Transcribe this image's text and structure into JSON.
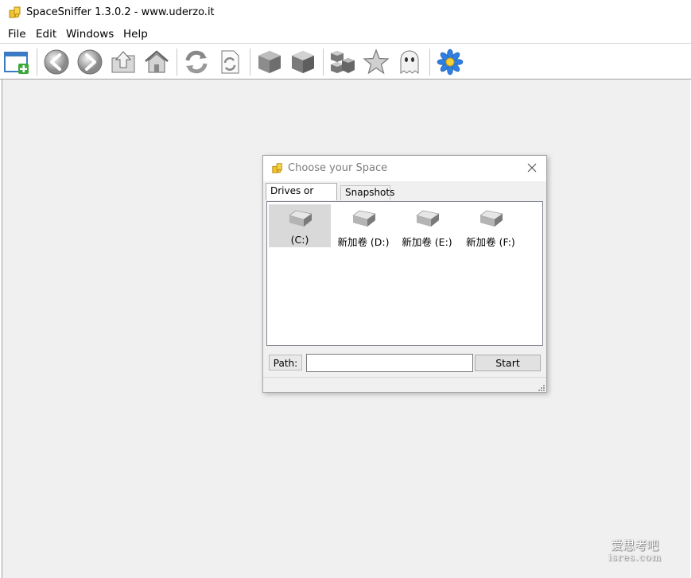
{
  "window": {
    "title": "SpaceSniffer 1.3.0.2 - www.uderzo.it"
  },
  "menu": [
    "File",
    "Edit",
    "Windows",
    "Help"
  ],
  "toolbar": {
    "buttons": [
      "new-window-icon",
      "back-icon",
      "forward-icon",
      "parent-folder-icon",
      "home-icon",
      "refresh-icon",
      "refresh-document-icon",
      "cube-icon",
      "cube-outline-icon",
      "cubes-icon",
      "star-icon",
      "ghost-icon",
      "flower-icon"
    ]
  },
  "dialog": {
    "title": "Choose your Space",
    "tabs": [
      "Drives or Paths",
      "Snapshots"
    ],
    "drives": [
      {
        "label": "(C:)",
        "selected": true
      },
      {
        "label": "新加卷 (D:)",
        "selected": false
      },
      {
        "label": "新加卷 (E:)",
        "selected": false
      },
      {
        "label": "新加卷 (F:)",
        "selected": false
      }
    ],
    "path_label": "Path:",
    "path_value": "",
    "start_label": "Start"
  },
  "watermark": {
    "line1": "爱思考吧",
    "line2": "isres.com"
  }
}
